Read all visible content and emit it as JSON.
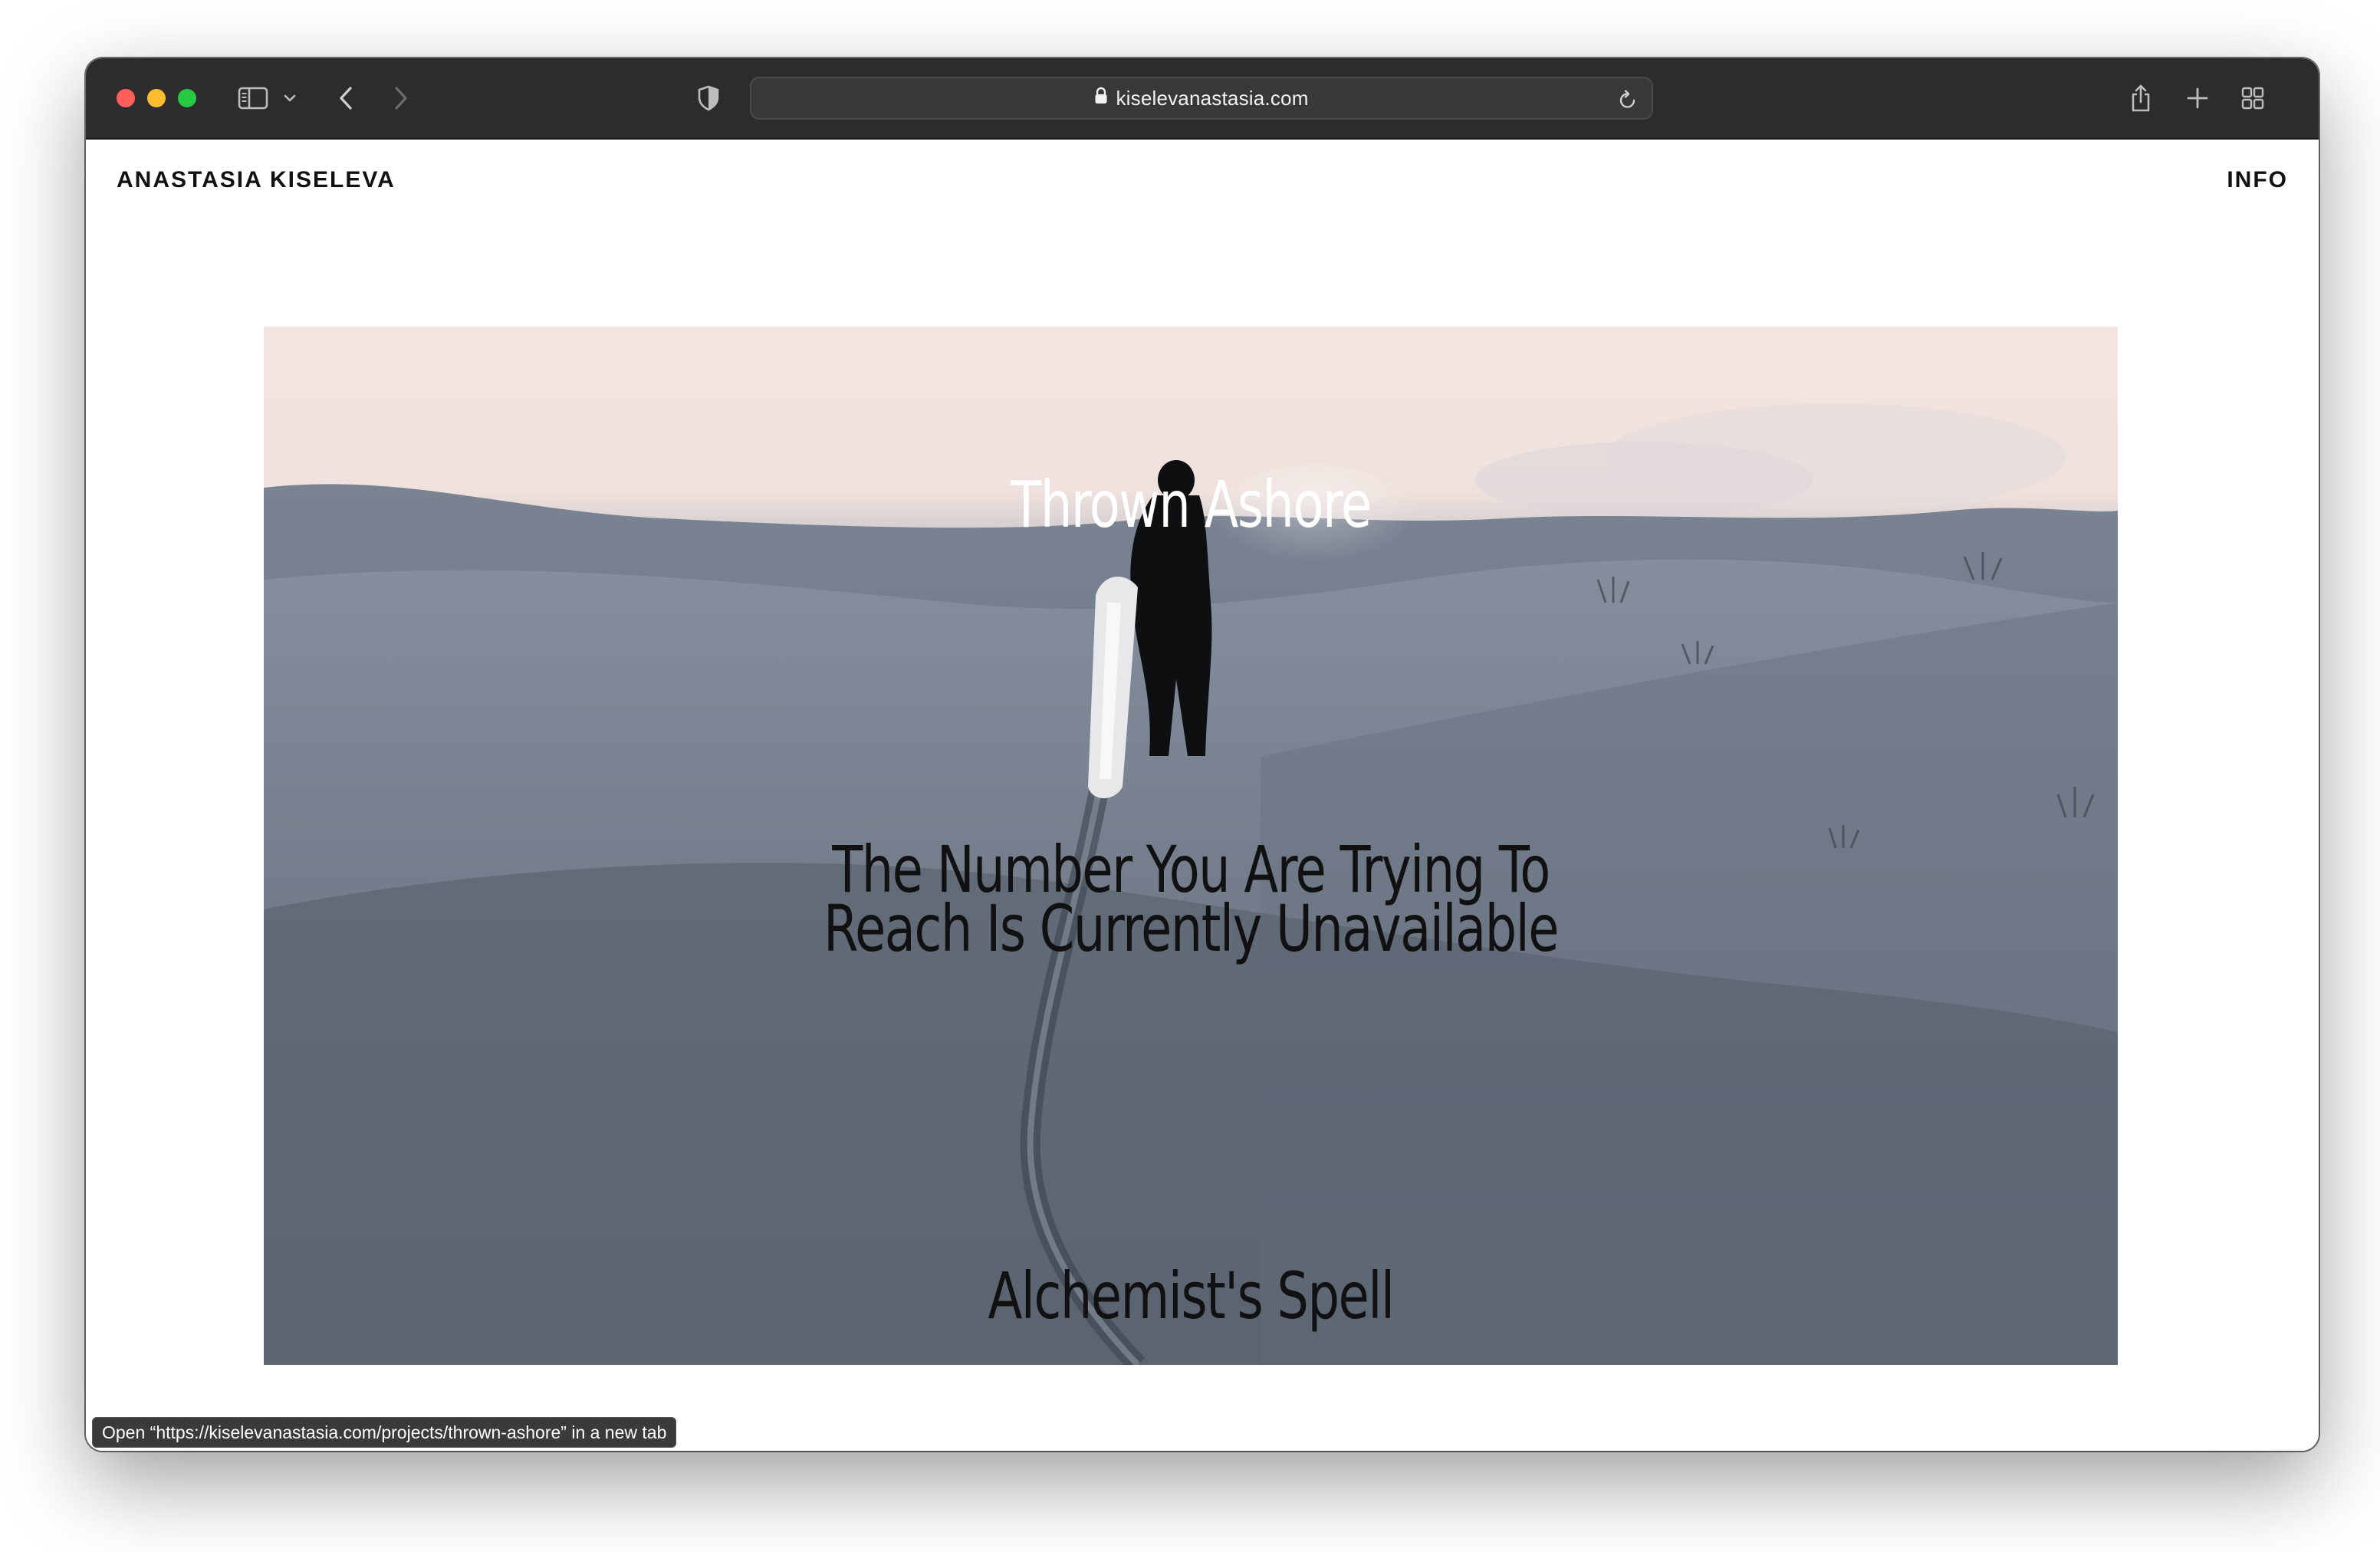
{
  "browser": {
    "url": "kiselevanastasia.com"
  },
  "site": {
    "title": "ANASTASIA KISELEVA",
    "nav_info": "INFO"
  },
  "projects": [
    {
      "title": "Thrown Ashore"
    },
    {
      "title_line1": "The Number You Are Trying To",
      "title_line2": "Reach Is Currently Unavailable"
    },
    {
      "title": "Alchemist's Spell"
    }
  ],
  "status": {
    "text": "Open “https://kiselevanastasia.com/projects/thrown-ashore” in a new tab"
  },
  "colors": {
    "toolbar": "#2c2c2e",
    "close": "#ff5f57",
    "minimize": "#febc2e",
    "zoom": "#28c840"
  }
}
